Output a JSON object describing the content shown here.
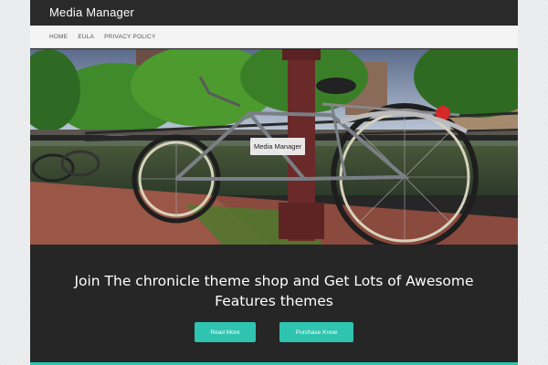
{
  "site": {
    "title": "Media Manager"
  },
  "nav": {
    "items": [
      {
        "label": "HOME"
      },
      {
        "label": "EULA"
      },
      {
        "label": "PRIVACY POLICY"
      }
    ]
  },
  "hero": {
    "caption": "Media Manager",
    "image": "bicycle-by-canal-photo"
  },
  "banner": {
    "headline_line1": "Join The chronicle theme shop and Get Lots of Awesome",
    "headline_line2": "Features themes",
    "read_more_label": "Read More",
    "purchase_label": "Purchase Know"
  },
  "colors": {
    "accent": "#2ec4b0",
    "header_bg": "#2a2a2a",
    "nav_bg": "#f4f4f4",
    "banner_bg": "#262626"
  }
}
